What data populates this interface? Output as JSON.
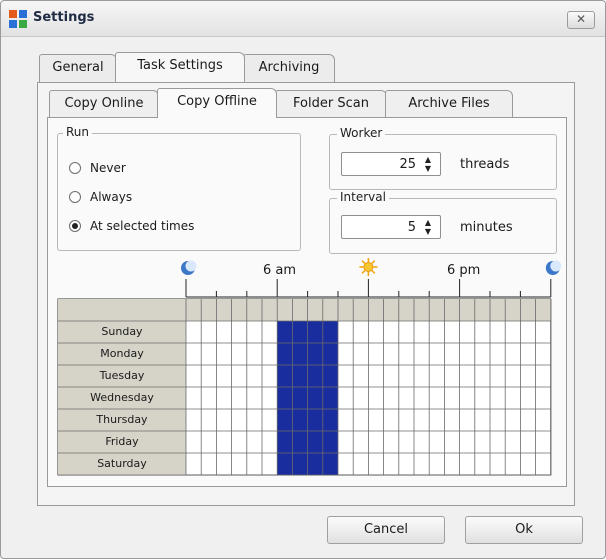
{
  "window": {
    "title": "Settings",
    "close_label": "✕"
  },
  "outer_tabs": [
    {
      "label": "General"
    },
    {
      "label": "Task Settings"
    },
    {
      "label": "Archiving"
    }
  ],
  "inner_tabs": [
    {
      "label": "Copy Online"
    },
    {
      "label": "Copy Offline"
    },
    {
      "label": "Folder Scan"
    },
    {
      "label": "Archive Files"
    }
  ],
  "run": {
    "label": "Run",
    "options": [
      {
        "label": "Never",
        "checked": false
      },
      {
        "label": "Always",
        "checked": false
      },
      {
        "label": "At selected times",
        "checked": true
      }
    ]
  },
  "worker": {
    "label": "Worker",
    "value": "25",
    "unit": "threads"
  },
  "interval": {
    "label": "Interval",
    "value": "5",
    "unit": "minutes"
  },
  "schedule": {
    "time_labels": {
      "am": "6 am",
      "pm": "6 pm"
    },
    "days": [
      "Sunday",
      "Monday",
      "Tuesday",
      "Wednesday",
      "Thursday",
      "Friday",
      "Saturday"
    ],
    "selected_hours": [
      6,
      7,
      8,
      9
    ],
    "colors": {
      "selected": "#1a2d9e",
      "header": "#d6d3c8",
      "grid_line": "#6a6a6a"
    }
  },
  "buttons": {
    "cancel": "Cancel",
    "ok": "Ok"
  }
}
